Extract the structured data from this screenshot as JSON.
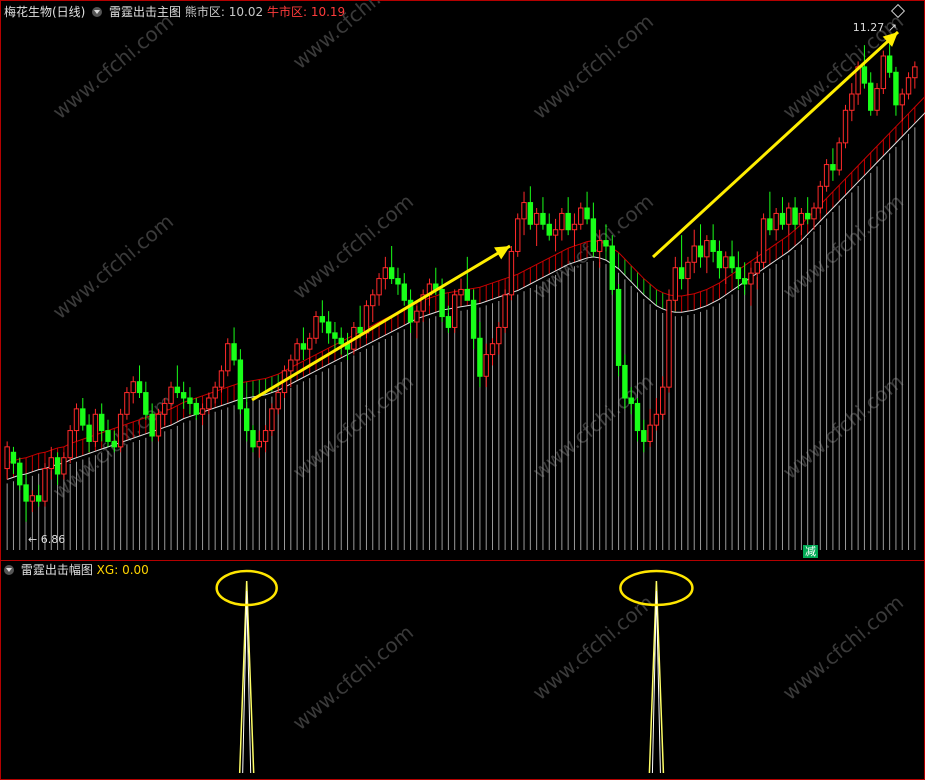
{
  "header": {
    "stock_name": "梅花生物(日线)",
    "main_indicator": "雷霆出击主图",
    "bear_label": "熊市区:",
    "bear_value": "10.02",
    "bull_label": "牛市区:",
    "bull_value": "10.19"
  },
  "sub_header": {
    "indicator": "雷霆出击幅图",
    "xg_label": "XG:",
    "xg_value": "0.00"
  },
  "labels": {
    "high_price": "11.27",
    "low_price": "6.86",
    "minus_tag": "减",
    "watermark": "www.cfchi.com"
  },
  "colors": {
    "up": "#ff2a2a",
    "down": "#19ff19",
    "band_red": "#c80000",
    "band_green": "#19c819",
    "arrow": "#ffee00",
    "signal": "#ffff66",
    "ellipse": "#ffe600"
  },
  "chart_data": [
    {
      "type": "candlestick",
      "title": "雷霆出击主图",
      "ylim": [
        6.6,
        11.5
      ],
      "annotations": [
        "11.27",
        "6.86"
      ],
      "candles": [
        [
          7.35,
          7.6,
          7.25,
          7.55
        ],
        [
          7.5,
          7.55,
          7.3,
          7.4
        ],
        [
          7.4,
          7.45,
          7.15,
          7.2
        ],
        [
          7.2,
          7.3,
          6.86,
          7.05
        ],
        [
          7.05,
          7.15,
          6.95,
          7.1
        ],
        [
          7.1,
          7.2,
          7.0,
          7.05
        ],
        [
          7.05,
          7.4,
          7.0,
          7.35
        ],
        [
          7.35,
          7.55,
          7.25,
          7.45
        ],
        [
          7.45,
          7.5,
          7.2,
          7.3
        ],
        [
          7.3,
          7.5,
          7.25,
          7.45
        ],
        [
          7.45,
          7.75,
          7.4,
          7.7
        ],
        [
          7.7,
          7.95,
          7.6,
          7.9
        ],
        [
          7.9,
          8.0,
          7.7,
          7.75
        ],
        [
          7.75,
          7.85,
          7.5,
          7.6
        ],
        [
          7.6,
          7.9,
          7.55,
          7.85
        ],
        [
          7.85,
          7.95,
          7.6,
          7.7
        ],
        [
          7.7,
          7.8,
          7.55,
          7.6
        ],
        [
          7.6,
          7.7,
          7.5,
          7.55
        ],
        [
          7.55,
          7.9,
          7.5,
          7.85
        ],
        [
          7.85,
          8.1,
          7.8,
          8.05
        ],
        [
          8.05,
          8.2,
          7.95,
          8.15
        ],
        [
          8.15,
          8.3,
          8.0,
          8.05
        ],
        [
          8.05,
          8.15,
          7.8,
          7.85
        ],
        [
          7.85,
          7.95,
          7.6,
          7.65
        ],
        [
          7.65,
          7.9,
          7.6,
          7.85
        ],
        [
          7.85,
          8.0,
          7.75,
          7.95
        ],
        [
          7.95,
          8.15,
          7.9,
          8.1
        ],
        [
          8.1,
          8.3,
          8.0,
          8.05
        ],
        [
          8.05,
          8.15,
          7.9,
          8.0
        ],
        [
          8.0,
          8.1,
          7.85,
          7.95
        ],
        [
          7.95,
          8.0,
          7.8,
          7.85
        ],
        [
          7.85,
          7.95,
          7.75,
          7.9
        ],
        [
          7.9,
          8.05,
          7.85,
          8.0
        ],
        [
          8.0,
          8.15,
          7.95,
          8.1
        ],
        [
          8.1,
          8.3,
          8.05,
          8.25
        ],
        [
          8.25,
          8.55,
          8.2,
          8.5
        ],
        [
          8.5,
          8.65,
          8.3,
          8.35
        ],
        [
          8.35,
          8.45,
          7.85,
          7.9
        ],
        [
          7.9,
          8.0,
          7.6,
          7.7
        ],
        [
          7.7,
          7.75,
          7.5,
          7.55
        ],
        [
          7.55,
          7.7,
          7.45,
          7.6
        ],
        [
          7.6,
          7.75,
          7.5,
          7.7
        ],
        [
          7.7,
          7.95,
          7.65,
          7.9
        ],
        [
          7.9,
          8.1,
          7.85,
          8.05
        ],
        [
          8.05,
          8.3,
          8.0,
          8.25
        ],
        [
          8.25,
          8.4,
          8.1,
          8.35
        ],
        [
          8.35,
          8.55,
          8.3,
          8.5
        ],
        [
          8.5,
          8.65,
          8.35,
          8.45
        ],
        [
          8.45,
          8.6,
          8.3,
          8.55
        ],
        [
          8.55,
          8.8,
          8.5,
          8.75
        ],
        [
          8.75,
          8.9,
          8.6,
          8.7
        ],
        [
          8.7,
          8.8,
          8.5,
          8.6
        ],
        [
          8.6,
          8.7,
          8.45,
          8.55
        ],
        [
          8.55,
          8.65,
          8.4,
          8.5
        ],
        [
          8.5,
          8.6,
          8.35,
          8.45
        ],
        [
          8.45,
          8.7,
          8.4,
          8.65
        ],
        [
          8.65,
          8.85,
          8.55,
          8.6
        ],
        [
          8.6,
          8.9,
          8.55,
          8.85
        ],
        [
          8.85,
          9.0,
          8.7,
          8.95
        ],
        [
          8.95,
          9.15,
          8.85,
          9.1
        ],
        [
          9.1,
          9.3,
          9.0,
          9.2
        ],
        [
          9.2,
          9.4,
          9.05,
          9.1
        ],
        [
          9.1,
          9.2,
          8.95,
          9.05
        ],
        [
          9.05,
          9.15,
          8.85,
          8.9
        ],
        [
          8.9,
          9.0,
          8.6,
          8.7
        ],
        [
          8.7,
          8.85,
          8.55,
          8.8
        ],
        [
          8.8,
          9.0,
          8.7,
          8.95
        ],
        [
          8.95,
          9.1,
          8.85,
          9.05
        ],
        [
          9.05,
          9.2,
          8.95,
          9.0
        ],
        [
          9.0,
          9.1,
          8.7,
          8.75
        ],
        [
          8.75,
          8.85,
          8.6,
          8.65
        ],
        [
          8.65,
          9.0,
          8.6,
          8.95
        ],
        [
          8.95,
          9.1,
          8.85,
          9.0
        ],
        [
          9.0,
          9.3,
          8.95,
          8.9
        ],
        [
          8.9,
          9.0,
          8.45,
          8.55
        ],
        [
          8.55,
          8.7,
          8.1,
          8.2
        ],
        [
          8.2,
          8.5,
          8.1,
          8.4
        ],
        [
          8.4,
          8.55,
          8.3,
          8.5
        ],
        [
          8.5,
          8.7,
          8.4,
          8.65
        ],
        [
          8.65,
          9.0,
          8.6,
          8.95
        ],
        [
          8.95,
          9.4,
          8.9,
          9.35
        ],
        [
          9.35,
          9.7,
          9.3,
          9.65
        ],
        [
          9.65,
          9.9,
          9.5,
          9.8
        ],
        [
          9.8,
          9.95,
          9.55,
          9.6
        ],
        [
          9.6,
          9.75,
          9.4,
          9.7
        ],
        [
          9.7,
          9.85,
          9.55,
          9.6
        ],
        [
          9.6,
          9.7,
          9.45,
          9.5
        ],
        [
          9.5,
          9.65,
          9.35,
          9.55
        ],
        [
          9.55,
          9.75,
          9.45,
          9.7
        ],
        [
          9.7,
          9.85,
          9.5,
          9.55
        ],
        [
          9.55,
          9.7,
          9.4,
          9.6
        ],
        [
          9.6,
          9.8,
          9.55,
          9.75
        ],
        [
          9.75,
          9.9,
          9.6,
          9.65
        ],
        [
          9.65,
          9.8,
          9.3,
          9.35
        ],
        [
          9.35,
          9.55,
          9.2,
          9.45
        ],
        [
          9.45,
          9.6,
          9.35,
          9.4
        ],
        [
          9.4,
          9.5,
          8.95,
          9.0
        ],
        [
          9.0,
          9.05,
          8.2,
          8.3
        ],
        [
          8.3,
          8.4,
          7.9,
          8.0
        ],
        [
          8.0,
          8.1,
          7.85,
          7.95
        ],
        [
          7.95,
          8.0,
          7.6,
          7.7
        ],
        [
          7.7,
          7.8,
          7.5,
          7.6
        ],
        [
          7.6,
          7.9,
          7.55,
          7.75
        ],
        [
          7.75,
          8.0,
          7.7,
          7.85
        ],
        [
          7.85,
          8.2,
          7.8,
          8.1
        ],
        [
          8.1,
          9.0,
          8.05,
          8.9
        ],
        [
          8.9,
          9.3,
          8.8,
          9.2
        ],
        [
          9.2,
          9.5,
          9.0,
          9.1
        ],
        [
          9.1,
          9.3,
          8.95,
          9.25
        ],
        [
          9.25,
          9.55,
          9.15,
          9.4
        ],
        [
          9.4,
          9.6,
          9.2,
          9.3
        ],
        [
          9.3,
          9.5,
          9.15,
          9.45
        ],
        [
          9.45,
          9.6,
          9.25,
          9.35
        ],
        [
          9.35,
          9.45,
          9.1,
          9.2
        ],
        [
          9.2,
          9.35,
          9.05,
          9.3
        ],
        [
          9.3,
          9.45,
          9.15,
          9.2
        ],
        [
          9.2,
          9.35,
          9.0,
          9.1
        ],
        [
          9.1,
          9.25,
          8.95,
          9.05
        ],
        [
          9.05,
          9.2,
          8.85,
          9.15
        ],
        [
          9.15,
          9.35,
          9.0,
          9.25
        ],
        [
          9.25,
          9.7,
          9.2,
          9.65
        ],
        [
          9.65,
          9.9,
          9.5,
          9.55
        ],
        [
          9.55,
          9.75,
          9.45,
          9.7
        ],
        [
          9.7,
          9.85,
          9.55,
          9.6
        ],
        [
          9.6,
          9.8,
          9.5,
          9.75
        ],
        [
          9.75,
          9.85,
          9.55,
          9.6
        ],
        [
          9.6,
          9.75,
          9.5,
          9.7
        ],
        [
          9.7,
          9.85,
          9.6,
          9.65
        ],
        [
          9.65,
          9.8,
          9.55,
          9.75
        ],
        [
          9.75,
          10.0,
          9.7,
          9.95
        ],
        [
          9.95,
          10.2,
          9.9,
          10.15
        ],
        [
          10.15,
          10.3,
          10.0,
          10.1
        ],
        [
          10.1,
          10.4,
          10.05,
          10.35
        ],
        [
          10.35,
          10.7,
          10.3,
          10.65
        ],
        [
          10.65,
          10.9,
          10.55,
          10.8
        ],
        [
          10.8,
          11.1,
          10.7,
          11.05
        ],
        [
          11.05,
          11.25,
          10.85,
          10.9
        ],
        [
          10.9,
          11.0,
          10.6,
          10.65
        ],
        [
          10.65,
          10.9,
          10.6,
          10.85
        ],
        [
          10.85,
          11.2,
          10.8,
          11.15
        ],
        [
          11.15,
          11.27,
          10.95,
          11.0
        ],
        [
          11.0,
          11.05,
          10.6,
          10.7
        ],
        [
          10.7,
          10.85,
          10.55,
          10.8
        ],
        [
          10.8,
          11.0,
          10.75,
          10.95
        ],
        [
          10.95,
          11.1,
          10.85,
          11.05
        ]
      ],
      "band_upper": [
        7.4,
        7.42,
        7.44,
        7.45,
        7.47,
        7.49,
        7.5,
        7.52,
        7.54,
        7.55,
        7.58,
        7.6,
        7.62,
        7.64,
        7.66,
        7.68,
        7.7,
        7.72,
        7.74,
        7.76,
        7.78,
        7.8,
        7.82,
        7.84,
        7.86,
        7.88,
        7.9,
        7.93,
        7.96,
        7.98,
        8.0,
        8.02,
        8.04,
        8.06,
        8.08,
        8.1,
        8.12,
        8.14,
        8.15,
        8.16,
        8.17,
        8.18,
        8.2,
        8.22,
        8.25,
        8.28,
        8.31,
        8.34,
        8.37,
        8.4,
        8.43,
        8.46,
        8.49,
        8.52,
        8.55,
        8.58,
        8.61,
        8.64,
        8.67,
        8.7,
        8.73,
        8.76,
        8.79,
        8.82,
        8.85,
        8.88,
        8.9,
        8.92,
        8.94,
        8.96,
        8.97,
        8.98,
        8.99,
        9.0,
        9.01,
        9.02,
        9.04,
        9.06,
        9.08,
        9.1,
        9.12,
        9.14,
        9.17,
        9.2,
        9.23,
        9.26,
        9.29,
        9.32,
        9.35,
        9.38,
        9.4,
        9.42,
        9.44,
        9.45,
        9.44,
        9.42,
        9.38,
        9.34,
        9.28,
        9.22,
        9.16,
        9.1,
        9.05,
        9.0,
        8.97,
        8.95,
        8.94,
        8.94,
        8.95,
        8.96,
        8.98,
        9.0,
        9.03,
        9.06,
        9.1,
        9.14,
        9.18,
        9.22,
        9.26,
        9.3,
        9.34,
        9.38,
        9.42,
        9.46,
        9.5,
        9.55,
        9.6,
        9.66,
        9.72,
        9.78,
        9.84,
        9.9,
        9.96,
        10.02,
        10.08,
        10.14,
        10.2,
        10.26,
        10.32,
        10.38,
        10.44,
        10.5,
        10.56,
        10.62,
        10.68,
        10.74,
        10.8,
        10.86,
        10.92,
        10.98,
        11.04,
        11.1
      ],
      "band_lower": [
        7.25,
        7.27,
        7.29,
        7.3,
        7.32,
        7.34,
        7.35,
        7.37,
        7.39,
        7.4,
        7.43,
        7.45,
        7.47,
        7.49,
        7.51,
        7.53,
        7.55,
        7.57,
        7.59,
        7.61,
        7.63,
        7.65,
        7.67,
        7.69,
        7.71,
        7.73,
        7.75,
        7.78,
        7.81,
        7.83,
        7.85,
        7.87,
        7.89,
        7.91,
        7.93,
        7.95,
        7.97,
        7.99,
        8.0,
        8.01,
        8.02,
        8.03,
        8.05,
        8.07,
        8.1,
        8.13,
        8.16,
        8.19,
        8.22,
        8.25,
        8.28,
        8.31,
        8.34,
        8.37,
        8.4,
        8.43,
        8.46,
        8.49,
        8.52,
        8.55,
        8.58,
        8.61,
        8.64,
        8.67,
        8.7,
        8.73,
        8.75,
        8.77,
        8.79,
        8.81,
        8.82,
        8.83,
        8.84,
        8.85,
        8.86,
        8.87,
        8.89,
        8.91,
        8.93,
        8.95,
        8.97,
        8.99,
        9.02,
        9.05,
        9.08,
        9.11,
        9.14,
        9.17,
        9.2,
        9.23,
        9.25,
        9.27,
        9.29,
        9.3,
        9.29,
        9.27,
        9.23,
        9.19,
        9.13,
        9.07,
        9.01,
        8.95,
        8.9,
        8.85,
        8.82,
        8.8,
        8.79,
        8.79,
        8.8,
        8.81,
        8.83,
        8.85,
        8.88,
        8.91,
        8.95,
        8.99,
        9.03,
        9.07,
        9.11,
        9.15,
        9.19,
        9.23,
        9.27,
        9.31,
        9.35,
        9.4,
        9.45,
        9.51,
        9.57,
        9.63,
        9.69,
        9.75,
        9.81,
        9.87,
        9.93,
        9.99,
        10.05,
        10.11,
        10.17,
        10.23,
        10.29,
        10.35,
        10.41,
        10.47,
        10.53,
        10.59,
        10.65,
        10.71,
        10.77,
        10.83,
        10.89,
        10.95
      ]
    },
    {
      "type": "line",
      "title": "雷霆出击幅图",
      "series": [
        {
          "name": "XG",
          "spikes_at_index": [
            38,
            103
          ],
          "baseline": 0,
          "peak": 1
        }
      ]
    }
  ]
}
